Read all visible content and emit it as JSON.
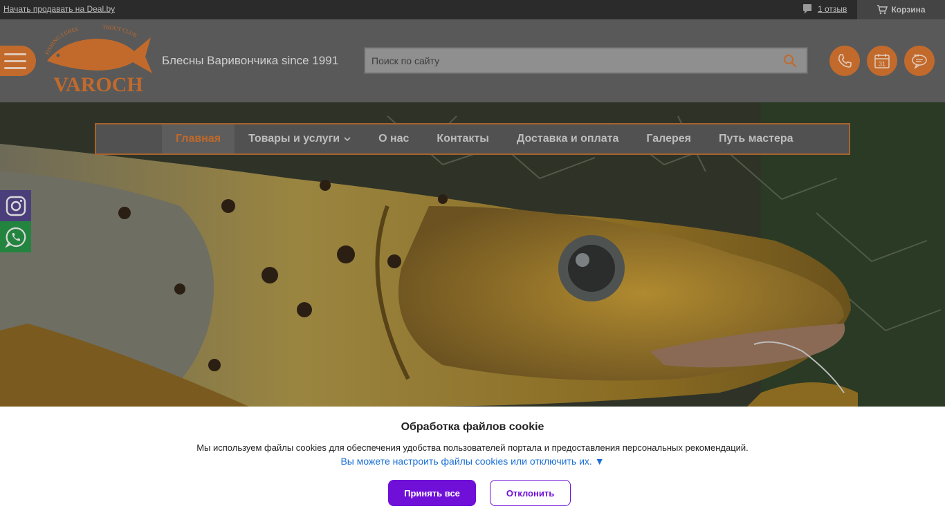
{
  "topbar": {
    "sell_link": "Начать продавать на Deal.by",
    "reviews_link": "1 отзыв",
    "cart_label": "Корзина"
  },
  "header": {
    "logo_text": "VAROCH",
    "logo_arc_left": "FISHING LURES",
    "logo_arc_right": "TROUT CLUB",
    "tagline": "Блесны Варивончика since 1991",
    "search_placeholder": "Поиск по сайту",
    "calendar_day": "31"
  },
  "nav": {
    "items": [
      {
        "label": "Главная"
      },
      {
        "label": "Товары и услуги"
      },
      {
        "label": "О нас"
      },
      {
        "label": "Контакты"
      },
      {
        "label": "Доставка и оплата"
      },
      {
        "label": "Галерея"
      },
      {
        "label": "Путь мастера"
      }
    ]
  },
  "cookie": {
    "title": "Обработка файлов cookie",
    "text": "Мы используем файлы cookies для обеспечения удобства пользователей портала и предоставления персональных рекомендаций.",
    "settings_link": "Вы можете настроить файлы cookies или отключить их.",
    "settings_arrow": "▼",
    "accept_label": "Принять все",
    "decline_label": "Отклонить"
  },
  "colors": {
    "accent": "#c26a2c",
    "button_primary": "#6f0fd8",
    "link": "#1a6fd6"
  }
}
